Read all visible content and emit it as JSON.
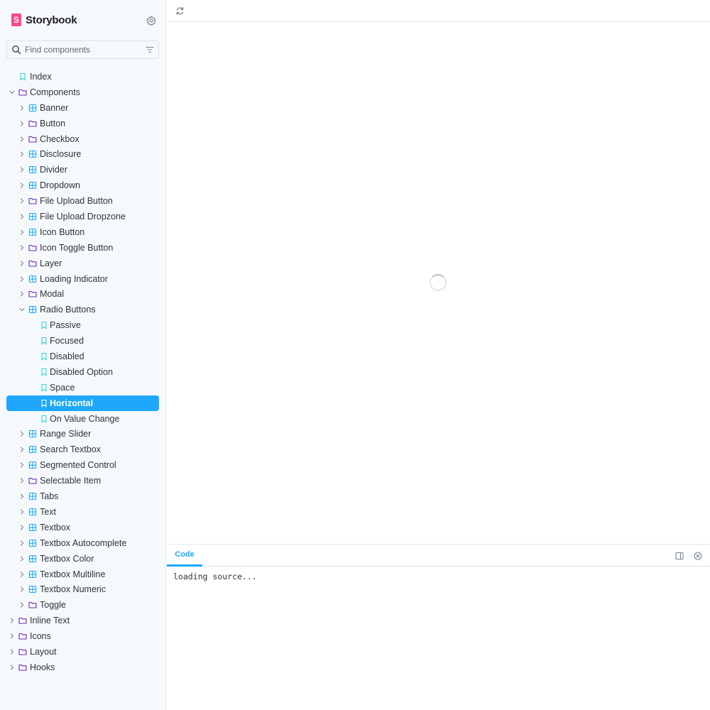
{
  "app": {
    "name": "Storybook"
  },
  "search": {
    "placeholder": "Find components",
    "value": ""
  },
  "colors": {
    "accent": "#1ea7fd",
    "brand": "#ff4785",
    "component_icon": "#1ea7fd",
    "folder_icon": "#6f2cac",
    "story_icon": "#37d5d3"
  },
  "tree": [
    {
      "label": "Index",
      "type": "story",
      "depth": 0,
      "expanded": null,
      "selected": false
    },
    {
      "label": "Components",
      "type": "folder",
      "depth": 0,
      "expanded": true,
      "selected": false
    },
    {
      "label": "Banner",
      "type": "component",
      "depth": 1,
      "expanded": false,
      "selected": false
    },
    {
      "label": "Button",
      "type": "folder",
      "depth": 1,
      "expanded": false,
      "selected": false
    },
    {
      "label": "Checkbox",
      "type": "folder",
      "depth": 1,
      "expanded": false,
      "selected": false
    },
    {
      "label": "Disclosure",
      "type": "component",
      "depth": 1,
      "expanded": false,
      "selected": false
    },
    {
      "label": "Divider",
      "type": "component",
      "depth": 1,
      "expanded": false,
      "selected": false
    },
    {
      "label": "Dropdown",
      "type": "component",
      "depth": 1,
      "expanded": false,
      "selected": false
    },
    {
      "label": "File Upload Button",
      "type": "folder",
      "depth": 1,
      "expanded": false,
      "selected": false
    },
    {
      "label": "File Upload Dropzone",
      "type": "component",
      "depth": 1,
      "expanded": false,
      "selected": false
    },
    {
      "label": "Icon Button",
      "type": "component",
      "depth": 1,
      "expanded": false,
      "selected": false
    },
    {
      "label": "Icon Toggle Button",
      "type": "folder",
      "depth": 1,
      "expanded": false,
      "selected": false
    },
    {
      "label": "Layer",
      "type": "folder",
      "depth": 1,
      "expanded": false,
      "selected": false
    },
    {
      "label": "Loading Indicator",
      "type": "component",
      "depth": 1,
      "expanded": false,
      "selected": false
    },
    {
      "label": "Modal",
      "type": "folder",
      "depth": 1,
      "expanded": false,
      "selected": false
    },
    {
      "label": "Radio Buttons",
      "type": "component",
      "depth": 1,
      "expanded": true,
      "selected": false
    },
    {
      "label": "Passive",
      "type": "story",
      "depth": 2,
      "expanded": null,
      "selected": false
    },
    {
      "label": "Focused",
      "type": "story",
      "depth": 2,
      "expanded": null,
      "selected": false
    },
    {
      "label": "Disabled",
      "type": "story",
      "depth": 2,
      "expanded": null,
      "selected": false
    },
    {
      "label": "Disabled Option",
      "type": "story",
      "depth": 2,
      "expanded": null,
      "selected": false
    },
    {
      "label": "Space",
      "type": "story",
      "depth": 2,
      "expanded": null,
      "selected": false
    },
    {
      "label": "Horizontal",
      "type": "story",
      "depth": 2,
      "expanded": null,
      "selected": true
    },
    {
      "label": "On Value Change",
      "type": "story",
      "depth": 2,
      "expanded": null,
      "selected": false
    },
    {
      "label": "Range Slider",
      "type": "component",
      "depth": 1,
      "expanded": false,
      "selected": false
    },
    {
      "label": "Search Textbox",
      "type": "component",
      "depth": 1,
      "expanded": false,
      "selected": false
    },
    {
      "label": "Segmented Control",
      "type": "component",
      "depth": 1,
      "expanded": false,
      "selected": false
    },
    {
      "label": "Selectable Item",
      "type": "folder",
      "depth": 1,
      "expanded": false,
      "selected": false
    },
    {
      "label": "Tabs",
      "type": "component",
      "depth": 1,
      "expanded": false,
      "selected": false
    },
    {
      "label": "Text",
      "type": "component",
      "depth": 1,
      "expanded": false,
      "selected": false
    },
    {
      "label": "Textbox",
      "type": "component",
      "depth": 1,
      "expanded": false,
      "selected": false
    },
    {
      "label": "Textbox Autocomplete",
      "type": "component",
      "depth": 1,
      "expanded": false,
      "selected": false
    },
    {
      "label": "Textbox Color",
      "type": "component",
      "depth": 1,
      "expanded": false,
      "selected": false
    },
    {
      "label": "Textbox Multiline",
      "type": "component",
      "depth": 1,
      "expanded": false,
      "selected": false
    },
    {
      "label": "Textbox Numeric",
      "type": "component",
      "depth": 1,
      "expanded": false,
      "selected": false
    },
    {
      "label": "Toggle",
      "type": "folder",
      "depth": 1,
      "expanded": false,
      "selected": false
    },
    {
      "label": "Inline Text",
      "type": "folder",
      "depth": 0,
      "expanded": false,
      "selected": false
    },
    {
      "label": "Icons",
      "type": "folder",
      "depth": 0,
      "expanded": false,
      "selected": false
    },
    {
      "label": "Layout",
      "type": "folder",
      "depth": 0,
      "expanded": false,
      "selected": false
    },
    {
      "label": "Hooks",
      "type": "folder",
      "depth": 0,
      "expanded": false,
      "selected": false
    }
  ],
  "panel": {
    "tabs": [
      {
        "label": "Code",
        "active": true
      }
    ],
    "code_text": "loading source..."
  }
}
